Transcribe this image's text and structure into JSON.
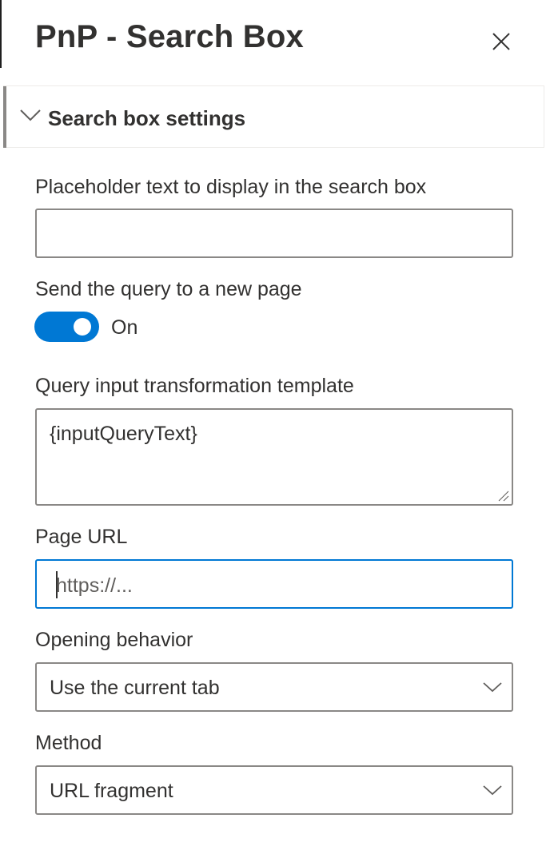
{
  "panel": {
    "title": "PnP - Search Box",
    "close_icon": "close-icon"
  },
  "group": {
    "label": "Search box settings",
    "chevron_icon": "chevron-down-icon"
  },
  "fields": {
    "placeholder": {
      "label": "Placeholder text to display in the search box",
      "value": ""
    },
    "send_query": {
      "label": "Send the query to a new page",
      "state": "On",
      "checked": true
    },
    "query_template": {
      "label": "Query input transformation template",
      "value": "{inputQueryText}"
    },
    "page_url": {
      "label": "Page URL",
      "placeholder": "https://..."
    },
    "opening_behavior": {
      "label": "Opening behavior",
      "selected": "Use the current tab"
    },
    "method": {
      "label": "Method",
      "selected": "URL fragment"
    }
  },
  "colors": {
    "accent": "#0078d4",
    "text": "#323130",
    "border": "#8a8886"
  }
}
